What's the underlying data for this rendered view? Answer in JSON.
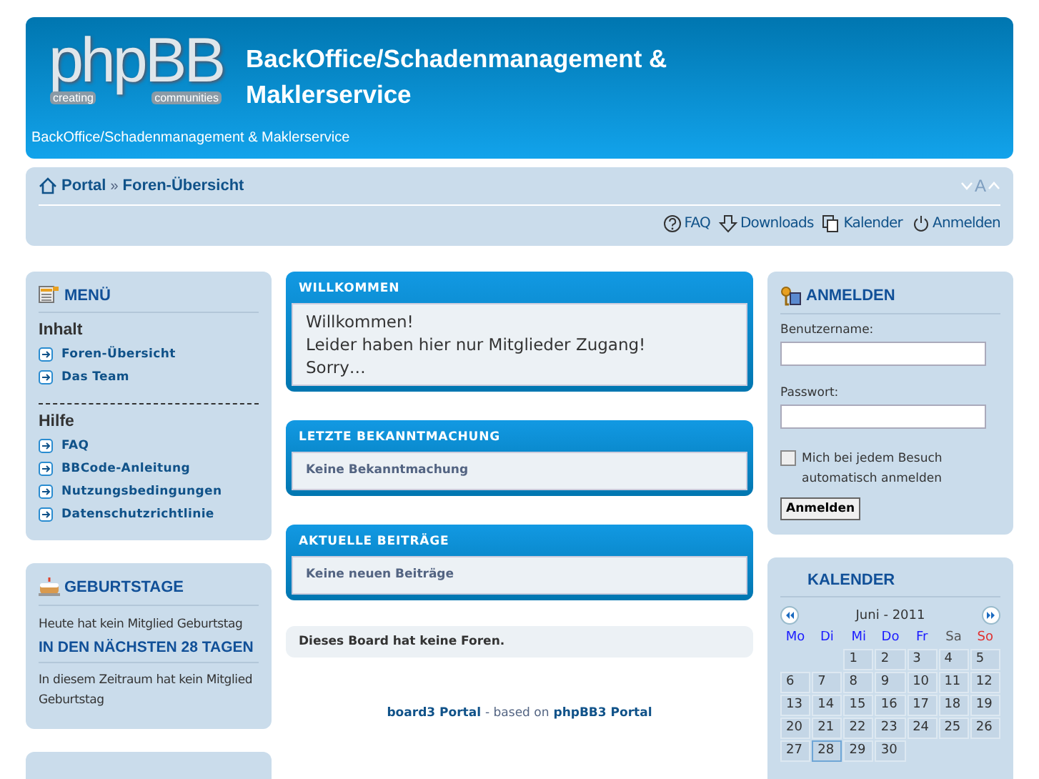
{
  "header": {
    "logo": {
      "wordmark": "phpBB",
      "tagline_left": "creating",
      "tagline_right": "communities"
    },
    "title": "BackOffice/Schadenmanagement & Maklerservice",
    "description": "BackOffice/Schadenmanagement & Maklerservice"
  },
  "navbar": {
    "breadcrumbs": [
      "Portal",
      "Foren-Übersicht"
    ],
    "separator": "»",
    "font_size_label": "A",
    "links": [
      {
        "kind": "faq",
        "label": "FAQ"
      },
      {
        "kind": "downloads",
        "label": "Downloads"
      },
      {
        "kind": "calendar",
        "label": "Kalender"
      },
      {
        "kind": "login",
        "label": "Anmelden"
      }
    ]
  },
  "menu": {
    "title": "MENÜ",
    "sections": [
      {
        "heading": "Inhalt",
        "items": [
          "Foren-Übersicht",
          "Das Team"
        ]
      },
      {
        "heading": "Hilfe",
        "items": [
          "FAQ",
          "BBCode-Anleitung",
          "Nutzungsbedingungen",
          "Datenschutzrichtlinie"
        ]
      }
    ]
  },
  "birthdays": {
    "title": "GEBURTSTAGE",
    "today": "Heute hat kein Mitglied Geburtstag",
    "upcoming_title": "IN DEN NÄCHSTEN 28 TAGEN",
    "upcoming": "In diesem Zeitraum hat kein Mitglied Geburtstag"
  },
  "center": [
    {
      "title": "WILLKOMMEN",
      "kind": "welcome",
      "lines": [
        "Willkommen!",
        "Leider haben hier nur Mitglieder Zugang!",
        "Sorry…"
      ]
    },
    {
      "title": "LETZTE BEKANNTMACHUNG",
      "kind": "note",
      "lines": [
        "Keine Bekanntmachung"
      ]
    },
    {
      "title": "AKTUELLE BEITRÄGE",
      "kind": "note",
      "lines": [
        "Keine neuen Beiträge"
      ]
    }
  ],
  "board_notice": "Dieses Board hat keine Foren.",
  "footer": {
    "link1": "board3 Portal",
    "middle": "- based on",
    "link2": "phpBB3 Portal"
  },
  "login": {
    "title": "ANMELDEN",
    "username_label": "Benutzername:",
    "password_label": "Passwort:",
    "remember": {
      "label": "Mich bei jedem Besuch automatisch anmelden",
      "checked": false
    },
    "button": "Anmelden"
  },
  "calendar": {
    "title": "KALENDER",
    "month": "Juni - 2011",
    "weekdays": [
      {
        "label": "Mo",
        "color": "#1a1aff"
      },
      {
        "label": "Di",
        "color": "#1a1aff"
      },
      {
        "label": "Mi",
        "color": "#1a1aff"
      },
      {
        "label": "Do",
        "color": "#1a1aff"
      },
      {
        "label": "Fr",
        "color": "#1a1aff"
      },
      {
        "label": "Sa",
        "color": "#555555"
      },
      {
        "label": "So",
        "color": "#e03030"
      }
    ],
    "weeks": [
      [
        {
          "kind": "empty"
        },
        {
          "kind": "empty"
        },
        {
          "day": "1",
          "selected": false
        },
        {
          "day": "2",
          "selected": false
        },
        {
          "day": "3",
          "selected": false
        },
        {
          "day": "4",
          "selected": false
        },
        {
          "day": "5",
          "selected": false
        }
      ],
      [
        {
          "day": "6",
          "selected": false
        },
        {
          "day": "7",
          "selected": false
        },
        {
          "day": "8",
          "selected": false
        },
        {
          "day": "9",
          "selected": false
        },
        {
          "day": "10",
          "selected": false
        },
        {
          "day": "11",
          "selected": false
        },
        {
          "day": "12",
          "selected": false
        }
      ],
      [
        {
          "day": "13",
          "selected": false
        },
        {
          "day": "14",
          "selected": false
        },
        {
          "day": "15",
          "selected": false
        },
        {
          "day": "16",
          "selected": false
        },
        {
          "day": "17",
          "selected": false
        },
        {
          "day": "18",
          "selected": false
        },
        {
          "day": "19",
          "selected": false
        }
      ],
      [
        {
          "day": "20",
          "selected": false
        },
        {
          "day": "21",
          "selected": false
        },
        {
          "day": "22",
          "selected": false
        },
        {
          "day": "23",
          "selected": false
        },
        {
          "day": "24",
          "selected": false
        },
        {
          "day": "25",
          "selected": false
        },
        {
          "day": "26",
          "selected": false
        }
      ],
      [
        {
          "day": "27",
          "selected": false
        },
        {
          "day": "28",
          "selected": true
        },
        {
          "day": "29",
          "selected": false
        },
        {
          "day": "30",
          "selected": false
        }
      ]
    ]
  }
}
